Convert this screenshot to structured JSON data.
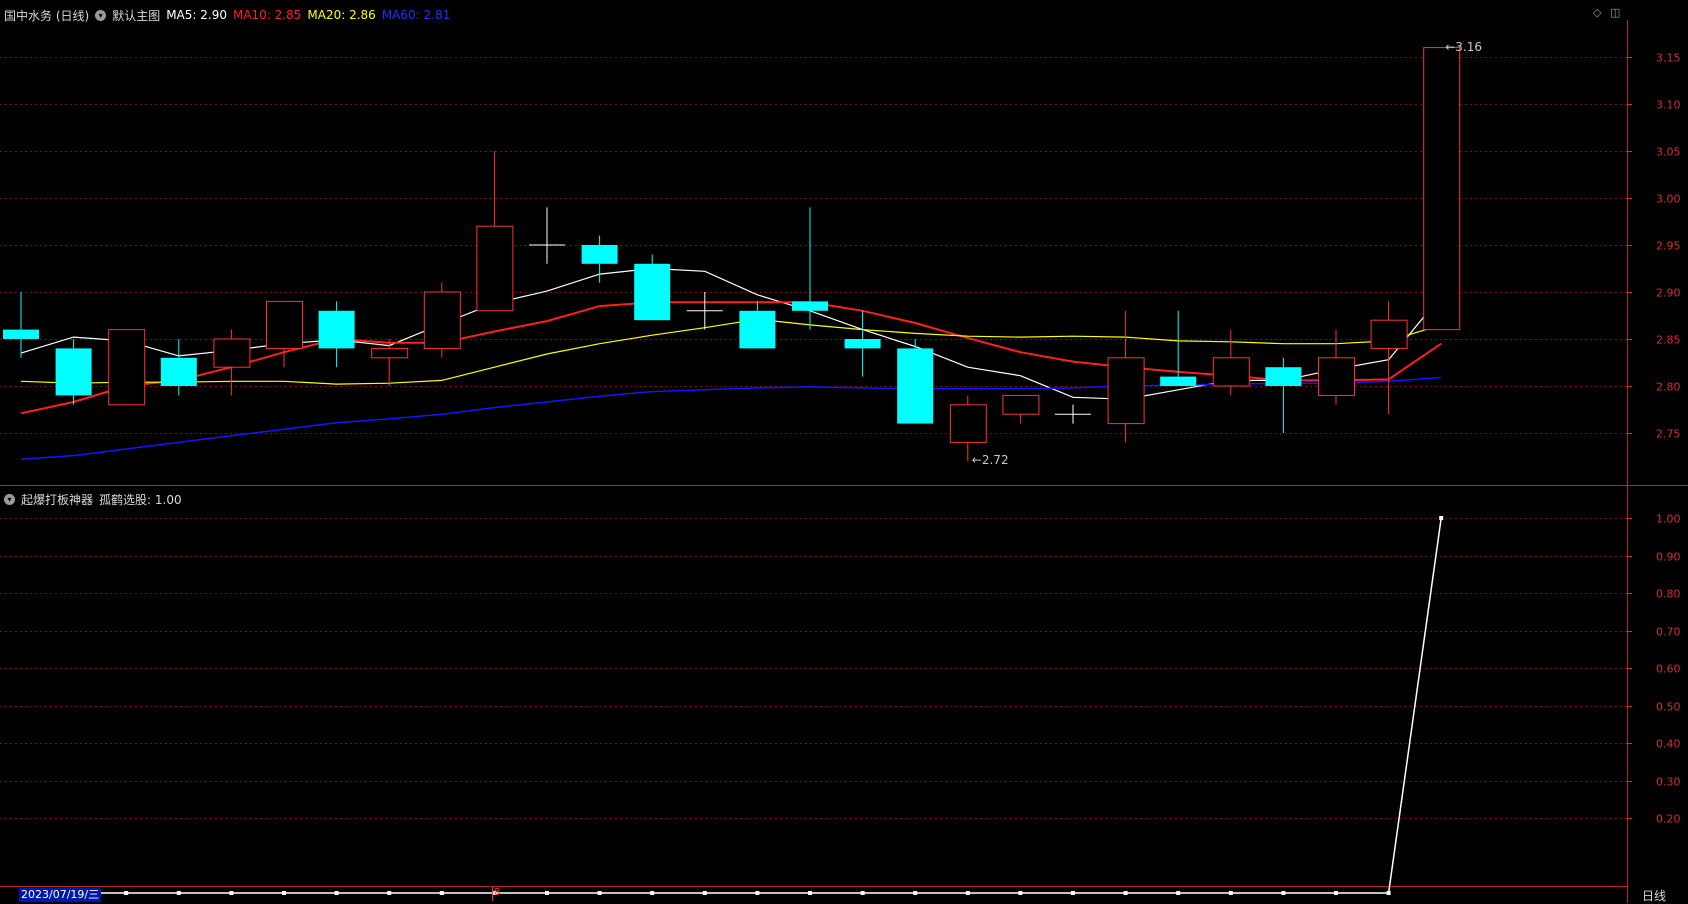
{
  "header": {
    "stock_title": "国中水务 (日线)",
    "template": "默认主图",
    "ma5_label": "MA5: 2.90",
    "ma10_label": "MA10: 2.85",
    "ma20_label": "MA20: 2.86",
    "ma60_label": "MA60: 2.81"
  },
  "indicator_header": {
    "name": "起爆打板神器",
    "value_label": "孤鹤选股: 1.00"
  },
  "footer": {
    "date": "2023/07/19/三",
    "marker": "8",
    "cycle": "日线"
  },
  "colors": {
    "up": "#ff3232",
    "down": "#00ffff",
    "ma5": "#ffffff",
    "ma10": "#ff2020",
    "ma20": "#ffff00",
    "ma60": "#1414ff",
    "grid": "#7a1010",
    "axis_text": "#d03030"
  },
  "chart_data": [
    {
      "type": "candlestick",
      "title": "国中水务 (日线)",
      "y_ticks": [
        "2.75",
        "2.80",
        "2.85",
        "2.90",
        "2.95",
        "3.00",
        "3.05",
        "3.10",
        "3.15"
      ],
      "ylim": [
        2.71,
        3.17
      ],
      "annotations": [
        {
          "label": "3.16",
          "kind": "high"
        },
        {
          "label": "2.72",
          "kind": "low"
        }
      ],
      "candles": [
        {
          "o": 2.86,
          "h": 2.9,
          "l": 2.83,
          "c": 2.85
        },
        {
          "o": 2.84,
          "h": 2.85,
          "l": 2.78,
          "c": 2.79
        },
        {
          "o": 2.78,
          "h": 2.86,
          "l": 2.78,
          "c": 2.86
        },
        {
          "o": 2.83,
          "h": 2.85,
          "l": 2.79,
          "c": 2.8
        },
        {
          "o": 2.82,
          "h": 2.86,
          "l": 2.79,
          "c": 2.85
        },
        {
          "o": 2.84,
          "h": 2.89,
          "l": 2.82,
          "c": 2.89
        },
        {
          "o": 2.88,
          "h": 2.89,
          "l": 2.82,
          "c": 2.84
        },
        {
          "o": 2.83,
          "h": 2.85,
          "l": 2.8,
          "c": 2.84
        },
        {
          "o": 2.84,
          "h": 2.91,
          "l": 2.83,
          "c": 2.9
        },
        {
          "o": 2.88,
          "h": 3.05,
          "l": 2.88,
          "c": 2.97
        },
        {
          "o": 2.95,
          "h": 2.99,
          "l": 2.93,
          "c": 2.95
        },
        {
          "o": 2.95,
          "h": 2.96,
          "l": 2.91,
          "c": 2.93
        },
        {
          "o": 2.93,
          "h": 2.94,
          "l": 2.87,
          "c": 2.87
        },
        {
          "o": 2.88,
          "h": 2.9,
          "l": 2.86,
          "c": 2.88
        },
        {
          "o": 2.88,
          "h": 2.89,
          "l": 2.84,
          "c": 2.84
        },
        {
          "o": 2.89,
          "h": 2.99,
          "l": 2.86,
          "c": 2.88
        },
        {
          "o": 2.85,
          "h": 2.88,
          "l": 2.81,
          "c": 2.84
        },
        {
          "o": 2.84,
          "h": 2.85,
          "l": 2.76,
          "c": 2.76
        },
        {
          "o": 2.74,
          "h": 2.79,
          "l": 2.72,
          "c": 2.78
        },
        {
          "o": 2.77,
          "h": 2.79,
          "l": 2.76,
          "c": 2.79
        },
        {
          "o": 2.77,
          "h": 2.78,
          "l": 2.76,
          "c": 2.77
        },
        {
          "o": 2.76,
          "h": 2.88,
          "l": 2.74,
          "c": 2.83
        },
        {
          "o": 2.81,
          "h": 2.88,
          "l": 2.8,
          "c": 2.8
        },
        {
          "o": 2.8,
          "h": 2.86,
          "l": 2.79,
          "c": 2.83
        },
        {
          "o": 2.82,
          "h": 2.83,
          "l": 2.75,
          "c": 2.8
        },
        {
          "o": 2.79,
          "h": 2.86,
          "l": 2.78,
          "c": 2.83
        },
        {
          "o": 2.84,
          "h": 2.89,
          "l": 2.77,
          "c": 2.87
        },
        {
          "o": 2.86,
          "h": 3.16,
          "l": 2.86,
          "c": 3.16
        }
      ],
      "series": [
        {
          "name": "MA5",
          "values": [
            2.835,
            2.852,
            2.848,
            2.832,
            2.838,
            2.845,
            2.849,
            2.843,
            2.866,
            2.888,
            2.901,
            2.919,
            2.925,
            2.922,
            2.897,
            2.88,
            2.86,
            2.842,
            2.82,
            2.811,
            2.788,
            2.786,
            2.796,
            2.806,
            2.806,
            2.818,
            2.828,
            2.896
          ]
        },
        {
          "name": "MA10",
          "values": [
            2.771,
            2.783,
            2.8,
            2.806,
            2.82,
            2.836,
            2.85,
            2.846,
            2.846,
            2.858,
            2.869,
            2.885,
            2.889,
            2.889,
            2.889,
            2.889,
            2.88,
            2.867,
            2.851,
            2.836,
            2.826,
            2.82,
            2.815,
            2.811,
            2.806,
            2.806,
            2.807,
            2.845
          ]
        },
        {
          "name": "MA20",
          "values": [
            2.805,
            2.803,
            2.804,
            2.804,
            2.805,
            2.805,
            2.802,
            2.803,
            2.806,
            2.82,
            2.834,
            2.845,
            2.854,
            2.862,
            2.871,
            2.865,
            2.86,
            2.856,
            2.853,
            2.852,
            2.853,
            2.852,
            2.848,
            2.847,
            2.845,
            2.845,
            2.848,
            2.865
          ]
        },
        {
          "name": "MA60",
          "values": [
            2.722,
            2.726,
            2.733,
            2.74,
            2.747,
            2.754,
            2.761,
            2.765,
            2.77,
            2.777,
            2.783,
            2.789,
            2.794,
            2.796,
            2.798,
            2.799,
            2.798,
            2.797,
            2.797,
            2.797,
            2.798,
            2.8,
            2.801,
            2.802,
            2.803,
            2.803,
            2.805,
            2.809
          ]
        }
      ]
    },
    {
      "type": "line",
      "title": "孤鹤选股",
      "y_ticks": [
        "0.20",
        "0.30",
        "0.40",
        "0.50",
        "0.60",
        "0.70",
        "0.80",
        "0.90",
        "1.00"
      ],
      "ylim": [
        0.0,
        1.05
      ],
      "series": [
        {
          "name": "孤鹤选股",
          "values": [
            0,
            0,
            0,
            0,
            0,
            0,
            0,
            0,
            0,
            0,
            0,
            0,
            0,
            0,
            0,
            0,
            0,
            0,
            0,
            0,
            0,
            0,
            0,
            0,
            0,
            0,
            0,
            1
          ]
        }
      ]
    }
  ]
}
